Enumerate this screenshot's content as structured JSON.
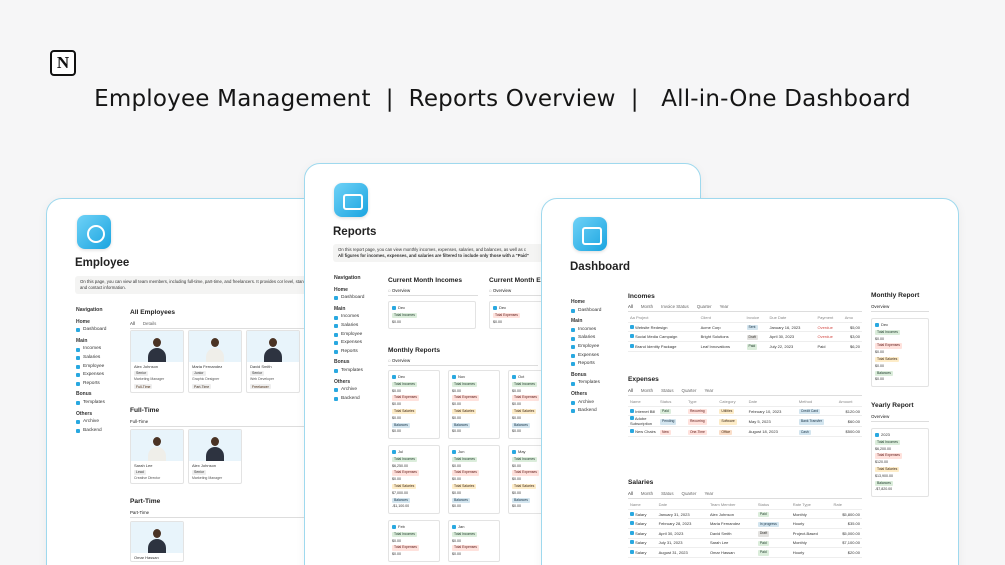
{
  "brand": {
    "logo_letter": "N"
  },
  "headline": "Employee Management  |  Reports Overview  |   All-in-One Dashboard",
  "colors": {
    "accent": "#29a8e0",
    "panel_border": "#9fd9ee"
  },
  "employee": {
    "title": "Employee",
    "callout": "On this page, you can view all team members, including full-time, part-time, and freelancers. It provides cor level, standard rate, position, and contact information.",
    "nav_title": "Navigation",
    "nav": [
      {
        "head": "Home"
      },
      {
        "item": "Dashboard"
      },
      {
        "head": "Main"
      },
      {
        "item": "Incomes"
      },
      {
        "item": "Salaries"
      },
      {
        "item": "Employee"
      },
      {
        "item": "Expenses"
      },
      {
        "item": "Reports"
      },
      {
        "head": "Bonus"
      },
      {
        "item": "Templates"
      },
      {
        "head": "Others"
      },
      {
        "item": "Archive"
      },
      {
        "item": "Backend"
      }
    ],
    "all_title": "All Employees",
    "all_tabs": [
      "All",
      "Details"
    ],
    "all_cards": [
      {
        "name": "Alex Johnson",
        "level": "Senior",
        "role": "Marketing Manager",
        "level_color": "gray"
      },
      {
        "name": "Maria Fernandez",
        "level": "Junior",
        "role": "Graphic Designer",
        "level_color": "gray"
      },
      {
        "name": "David Smith",
        "level": "Senior",
        "role": "Web Developer",
        "level_color": "gray"
      }
    ],
    "all_tags": [
      "Full-Time",
      "Part-Time",
      "Freelancer"
    ],
    "fulltime_title": "Full-Time",
    "fulltime_tab": "Full-Time",
    "fulltime_cards": [
      {
        "name": "Sarah Lee",
        "level": "Lead",
        "role": "Creative Director"
      },
      {
        "name": "Alex Johnson",
        "level": "Senior",
        "role": "Marketing Manager"
      }
    ],
    "parttime_title": "Part-Time",
    "parttime_tab": "Part-Time",
    "parttime_cards": [
      {
        "name": "Omar Hassan"
      }
    ]
  },
  "reports": {
    "title": "Reports",
    "callout_1": "On this report page, you can view monthly incomes, expenses, salaries, and balances, as well as c",
    "callout_2": "All figures for incomes, expenses, and salaries are filtered to include only those with a \"Paid\"",
    "nav_title": "Navigation",
    "nav": [
      {
        "head": "Home"
      },
      {
        "item": "Dashboard"
      },
      {
        "head": "Main"
      },
      {
        "item": "Incomes"
      },
      {
        "item": "Salaries"
      },
      {
        "item": "Employee"
      },
      {
        "item": "Expenses"
      },
      {
        "item": "Reports"
      },
      {
        "head": "Bonus"
      },
      {
        "item": "Templates"
      },
      {
        "head": "Others"
      },
      {
        "item": "Archive"
      },
      {
        "item": "Backend"
      }
    ],
    "cm_incomes_title": "Current Month Incomes",
    "cm_expenses_title": "Current Month Expe",
    "overview_tab": "Overview",
    "cm_incomes_card": {
      "month": "Dec",
      "label": "Total Incomes",
      "value": "$0.00"
    },
    "cm_expenses_card": {
      "month": "Dec",
      "label": "Total Expenses",
      "value": "$0.00"
    },
    "monthly_title": "Monthly Reports",
    "monthly_cards": [
      {
        "month": "Dec",
        "ti": "$0.00",
        "te": "$0.00",
        "ts": "$0.00",
        "bal": "$0.00"
      },
      {
        "month": "Nov",
        "ti": "$0.00",
        "te": "$0.00",
        "ts": "$0.00",
        "bal": "$0.00"
      },
      {
        "month": "Oct",
        "ti": "$0.00",
        "te": "$0.00",
        "ts": "$0.00",
        "bal": "$0.00"
      },
      {
        "month": "Jul",
        "ti": "$6,250.00",
        "te": "$0.00",
        "ts": "$7,000.00",
        "bal": "-$1,100.00"
      },
      {
        "month": "Jun",
        "ti": "$0.00",
        "te": "$0.00",
        "ts": "$0.00",
        "bal": "$0.00"
      },
      {
        "month": "May",
        "ti": "$0.00",
        "te": "$0.00",
        "ts": "$0.00",
        "bal": "$0.00"
      },
      {
        "month": "Feb",
        "ti": "$0.00",
        "te": "$0.00",
        "ts": "",
        "bal": ""
      },
      {
        "month": "Jan",
        "ti": "$0.00",
        "te": "$0.00",
        "ts": "",
        "bal": ""
      }
    ],
    "labels": {
      "ti": "Total Incomes",
      "te": "Total Expenses",
      "ts": "Total Salaries",
      "bal": "Balances"
    }
  },
  "dashboard": {
    "title": "Dashboard",
    "nav": [
      {
        "head": "Home"
      },
      {
        "item": "Dashboard"
      },
      {
        "head": "Main"
      },
      {
        "item": "Incomes"
      },
      {
        "item": "Salaries"
      },
      {
        "item": "Employee"
      },
      {
        "item": "Expenses"
      },
      {
        "item": "Reports"
      },
      {
        "head": "Bonus"
      },
      {
        "item": "Templates"
      },
      {
        "head": "Others"
      },
      {
        "item": "Archive"
      },
      {
        "item": "Backend"
      }
    ],
    "incomes": {
      "title": "Incomes",
      "tabs": [
        "All",
        "Month",
        "Invoice Status",
        "Quarter",
        "Year"
      ],
      "columns": [
        "Aa Project",
        "Client",
        "Invoice",
        "Due Date",
        "Payment",
        "Amo"
      ],
      "rows": [
        {
          "project": "Website Redesign",
          "client": "Acme Corp",
          "invoice": "Sent",
          "due": "January 16, 2023",
          "payment": "Overdue",
          "amount": "$5,00",
          "inv_color": "blue",
          "pay_color": "red"
        },
        {
          "project": "Social Media Campaign",
          "client": "Bright Solutions",
          "invoice": "Draft",
          "due": "April 30, 2023",
          "payment": "Overdue",
          "amount": "$3,00",
          "inv_color": "gray",
          "pay_color": "red"
        },
        {
          "project": "Brand Identity Package",
          "client": "Leaf Innovations",
          "invoice": "Paid",
          "due": "July 22, 2023",
          "payment": "Paid",
          "amount": "$6,20",
          "inv_color": "green",
          "pay_color": "green"
        }
      ]
    },
    "expenses": {
      "title": "Expenses",
      "tabs": [
        "All",
        "Month",
        "Status",
        "Quarter",
        "Year"
      ],
      "columns": [
        "Name",
        "Status",
        "Type",
        "Category",
        "Date",
        "Method",
        "Amount"
      ],
      "rows": [
        {
          "name": "Internet Bill",
          "status": "Paid",
          "type": "Recurring",
          "category": "Utilities",
          "date": "February 10, 2023",
          "method": "Credit Card",
          "amount": "$120.00",
          "st_color": "green",
          "cat_color": "yellow"
        },
        {
          "name": "Adobe Subscription",
          "status": "Pending",
          "type": "Recurring",
          "category": "Software",
          "date": "May 5, 2023",
          "method": "Bank Transfer",
          "amount": "$60.00",
          "st_color": "blue",
          "cat_color": "yellow"
        },
        {
          "name": "New Chairs",
          "status": "New",
          "type": "One-Time",
          "category": "Office",
          "date": "August 18, 2023",
          "method": "Cash",
          "amount": "$500.00",
          "st_color": "red",
          "cat_color": "orange"
        }
      ]
    },
    "salaries": {
      "title": "Salaries",
      "tabs": [
        "All",
        "Month",
        "Status",
        "Quarter",
        "Year"
      ],
      "columns": [
        "Name",
        "Date",
        "Team Member",
        "Status",
        "Rate Type",
        "Rate"
      ],
      "rows": [
        {
          "name": "Salary",
          "date": "January 31, 2023",
          "member": "Alex Johnson",
          "status": "Paid",
          "rate_type": "Monthly",
          "rate": "$5,800.00",
          "st_color": "green"
        },
        {
          "name": "Salary",
          "date": "February 28, 2023",
          "member": "Maria Fernandez",
          "status": "In progress",
          "rate_type": "Hourly",
          "rate": "$35.00",
          "st_color": "blue"
        },
        {
          "name": "Salary",
          "date": "April 30, 2023",
          "member": "David Smith",
          "status": "Draft",
          "rate_type": "Project-Based",
          "rate": "$5,000.00",
          "st_color": "gray"
        },
        {
          "name": "Salary",
          "date": "July 31, 2023",
          "member": "Sarah Lee",
          "status": "Paid",
          "rate_type": "Monthly",
          "rate": "$7,100.00",
          "st_color": "green"
        },
        {
          "name": "Salary",
          "date": "August 31, 2023",
          "member": "Omar Hassan",
          "status": "Paid",
          "rate_type": "Hourly",
          "rate": "$20.00",
          "st_color": "green"
        }
      ]
    },
    "monthly_report": {
      "title": "Monthly Report",
      "tab": "Overview",
      "month": "Dec",
      "lines": [
        {
          "label": "Total Incomes",
          "value": "$0.00",
          "color": "green"
        },
        {
          "label": "Total Expenses",
          "value": "$0.00",
          "color": "red"
        },
        {
          "label": "Total Salaries",
          "value": "$0.00",
          "color": "yellow"
        },
        {
          "label": "Balances",
          "value": "$0.00",
          "color": "green"
        }
      ]
    },
    "yearly_report": {
      "title": "Yearly Report",
      "tab": "Overview",
      "year": "2023",
      "lines": [
        {
          "label": "Total Incomes",
          "value": "$6,200.00",
          "color": "green"
        },
        {
          "label": "Total Expenses",
          "value": "$120.00",
          "color": "red"
        },
        {
          "label": "Total Salaries",
          "value": "$13,900.00",
          "color": "yellow"
        },
        {
          "label": "Balances",
          "value": "-$7,820.00",
          "color": "green"
        }
      ]
    }
  }
}
